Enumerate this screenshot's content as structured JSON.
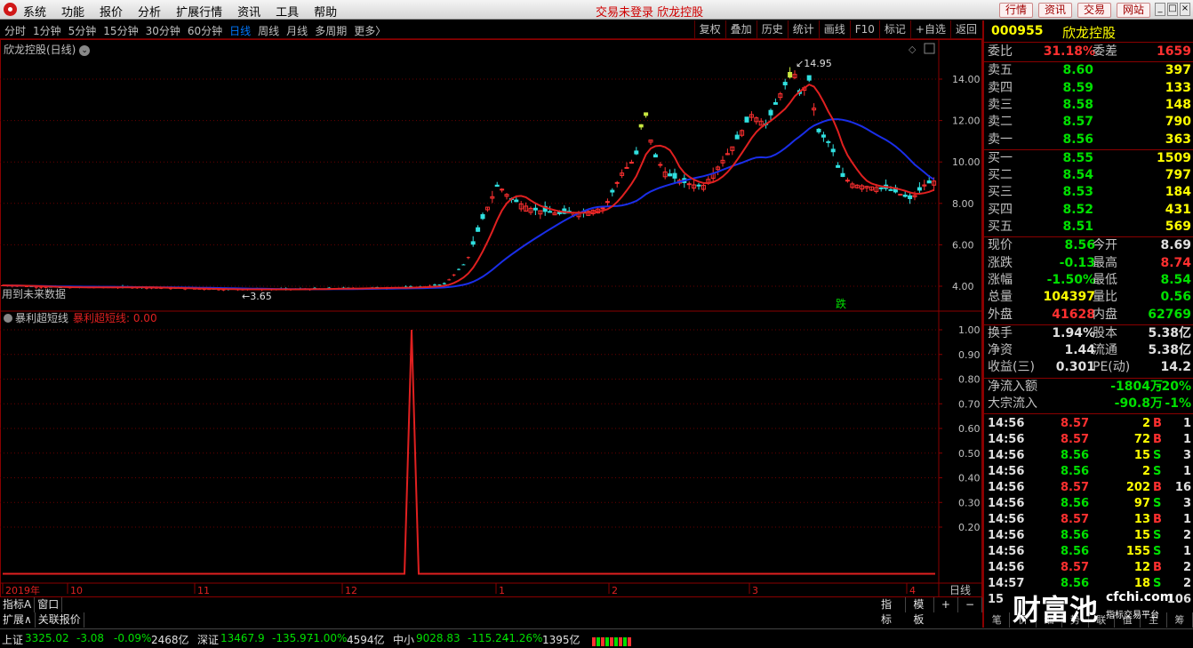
{
  "menubar": {
    "items": [
      "系统",
      "功能",
      "报价",
      "分析",
      "扩展行情",
      "资讯",
      "工具",
      "帮助"
    ],
    "title": "交易未登录  欣龙控股",
    "buttons": [
      "行情",
      "资讯",
      "交易",
      "网站"
    ]
  },
  "periods": [
    "分时",
    "1分钟",
    "5分钟",
    "15分钟",
    "30分钟",
    "60分钟",
    "日线",
    "周线",
    "月线",
    "多周期",
    "更多〉"
  ],
  "active_period": "日线",
  "tools": [
    "复权",
    "叠加",
    "历史",
    "统计",
    "画线",
    "F10",
    "标记",
    "+自选",
    "返回"
  ],
  "main_chart": {
    "title": "欣龙控股(日线)",
    "y_ticks": [
      "14.00",
      "12.00",
      "10.00",
      "8.00",
      "6.00",
      "4.00"
    ],
    "high_label": "14.95",
    "low_label": "3.65",
    "future_label": "用到未来数据",
    "signal_label": "跌",
    "colors": {
      "ma_short": "#e02020",
      "ma_long": "#1a2ee8",
      "up": "#ff3030",
      "down": "#30e0e0",
      "grid": "#6a0000",
      "special": "#c8e840"
    }
  },
  "indicator": {
    "name": "暴利超短线",
    "value_label": "暴利超短线: 0.00",
    "y_ticks": [
      "1.00",
      "0.90",
      "0.80",
      "0.70",
      "0.60",
      "0.50",
      "0.40",
      "0.30",
      "0.20"
    ]
  },
  "time_axis": {
    "labels": [
      "2019年",
      "10",
      "11",
      "12",
      "1",
      "2",
      "3",
      "4"
    ],
    "period": "日线"
  },
  "bottom_tabs": {
    "row1": [
      "指标A",
      "窗口"
    ],
    "row2": [
      "扩展∧",
      "关联报价"
    ],
    "right": [
      "指标B",
      "模板",
      "+",
      "−"
    ]
  },
  "stock": {
    "code": "000955",
    "name": "欣龙控股"
  },
  "orderbook": {
    "weibi": {
      "label": "委比",
      "value": "31.18%",
      "label2": "委差",
      "value2": "1659"
    },
    "asks": [
      {
        "label": "卖五",
        "price": "8.60",
        "vol": "397"
      },
      {
        "label": "卖四",
        "price": "8.59",
        "vol": "133"
      },
      {
        "label": "卖三",
        "price": "8.58",
        "vol": "148"
      },
      {
        "label": "卖二",
        "price": "8.57",
        "vol": "790"
      },
      {
        "label": "卖一",
        "price": "8.56",
        "vol": "363"
      }
    ],
    "bids": [
      {
        "label": "买一",
        "price": "8.55",
        "vol": "1509"
      },
      {
        "label": "买二",
        "price": "8.54",
        "vol": "797"
      },
      {
        "label": "买三",
        "price": "8.53",
        "vol": "184"
      },
      {
        "label": "买四",
        "price": "8.52",
        "vol": "431"
      },
      {
        "label": "买五",
        "price": "8.51",
        "vol": "569"
      }
    ]
  },
  "quote": [
    {
      "l1": "现价",
      "v1": "8.56",
      "c1": "g",
      "l2": "今开",
      "v2": "8.69",
      "c2": "w"
    },
    {
      "l1": "涨跌",
      "v1": "-0.13",
      "c1": "g",
      "l2": "最高",
      "v2": "8.74",
      "c2": "r"
    },
    {
      "l1": "涨幅",
      "v1": "-1.50%",
      "c1": "g",
      "l2": "最低",
      "v2": "8.54",
      "c2": "g"
    },
    {
      "l1": "总量",
      "v1": "104397",
      "c1": "y",
      "l2": "量比",
      "v2": "0.56",
      "c2": "g"
    },
    {
      "l1": "外盘",
      "v1": "41628",
      "c1": "r",
      "l2": "内盘",
      "v2": "62769",
      "c2": "g"
    }
  ],
  "fundamentals": [
    {
      "l1": "换手",
      "v1": "1.94%",
      "l2": "股本",
      "v2": "5.38亿"
    },
    {
      "l1": "净资",
      "v1": "1.44",
      "l2": "流通",
      "v2": "5.38亿"
    },
    {
      "l1": "收益(三)",
      "v1": "0.301",
      "l2": "PE(动)",
      "v2": "14.2"
    }
  ],
  "flows": [
    {
      "label": "净流入额",
      "value": "-1804万",
      "pct": "-20%"
    },
    {
      "label": "大宗流入",
      "value": "-90.8万",
      "pct": "-1%"
    }
  ],
  "ticks": [
    {
      "time": "14:56",
      "price": "8.57",
      "vol": "2",
      "side": "B",
      "n": "1"
    },
    {
      "time": "14:56",
      "price": "8.57",
      "vol": "72",
      "side": "B",
      "n": "1"
    },
    {
      "time": "14:56",
      "price": "8.56",
      "vol": "15",
      "side": "S",
      "n": "3"
    },
    {
      "time": "14:56",
      "price": "8.56",
      "vol": "2",
      "side": "S",
      "n": "1"
    },
    {
      "time": "14:56",
      "price": "8.57",
      "vol": "202",
      "side": "B",
      "n": "16"
    },
    {
      "time": "14:56",
      "price": "8.56",
      "vol": "97",
      "side": "S",
      "n": "3"
    },
    {
      "time": "14:56",
      "price": "8.57",
      "vol": "13",
      "side": "B",
      "n": "1"
    },
    {
      "time": "14:56",
      "price": "8.56",
      "vol": "15",
      "side": "S",
      "n": "2"
    },
    {
      "time": "14:56",
      "price": "8.56",
      "vol": "155",
      "side": "S",
      "n": "1"
    },
    {
      "time": "14:56",
      "price": "8.57",
      "vol": "12",
      "side": "B",
      "n": "2"
    },
    {
      "time": "14:57",
      "price": "8.56",
      "vol": "18",
      "side": "S",
      "n": "2"
    },
    {
      "time": "15",
      "price": "",
      "vol": "",
      "side": "",
      "n": "106"
    }
  ],
  "rp_tabs": [
    "笔",
    "价",
    "细",
    "势",
    "联",
    "值",
    "主",
    "筹"
  ],
  "watermark": {
    "brand": "财富池",
    "site": "cfchi.com",
    "sub": "指标交易平台"
  },
  "status": [
    {
      "name": "上证",
      "index": "3325.02",
      "chg": "-3.08",
      "pct": "-0.09%",
      "amt": "2468亿"
    },
    {
      "name": "深证",
      "index": "13467.9",
      "chg": "-135.97",
      "pct": "-1.00%",
      "amt": "4594亿"
    },
    {
      "name": "中小",
      "index": "9028.83",
      "chg": "-115.24",
      "pct": "-1.26%",
      "amt": "1395亿"
    }
  ]
}
